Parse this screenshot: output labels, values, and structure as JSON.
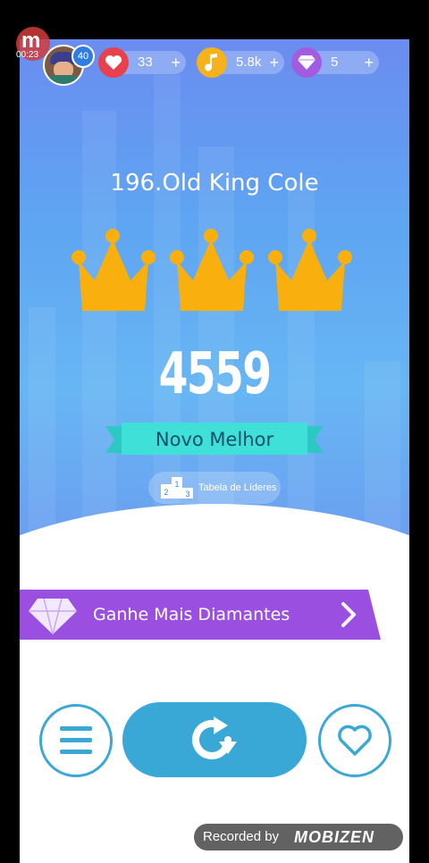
{
  "status": {
    "recorder_time": "00:23",
    "recorder_letter": "m"
  },
  "player": {
    "level": "40"
  },
  "currencies": [
    {
      "name": "lives",
      "value": "33",
      "plus": "+",
      "icon": "heart-icon",
      "color": "#e8404d"
    },
    {
      "name": "notes",
      "value": "5.8k",
      "plus": "+",
      "icon": "music-note-icon",
      "color": "#f6b21b"
    },
    {
      "name": "diamonds",
      "value": "5",
      "plus": "+",
      "icon": "diamond-icon",
      "color": "#a35ce0"
    }
  ],
  "result": {
    "song_title": "196.Old King Cole",
    "crowns_earned": 3,
    "crowns_total": 3,
    "score": "4559",
    "badge": "Novo Melhor",
    "leaderboard_label": "Tabela de Líderes",
    "podium": [
      "2",
      "1",
      "3"
    ]
  },
  "promo": {
    "label": "Ganhe Mais Diamantes",
    "color": "#9b4fe0"
  },
  "actions": {
    "menu_icon": "menu-icon",
    "replay_icon": "replay-icon",
    "like_icon": "heart-outline-icon",
    "accent": "#3aa8d6"
  },
  "watermark": {
    "label": "Recorded by",
    "logo": "MOBIZEN"
  }
}
